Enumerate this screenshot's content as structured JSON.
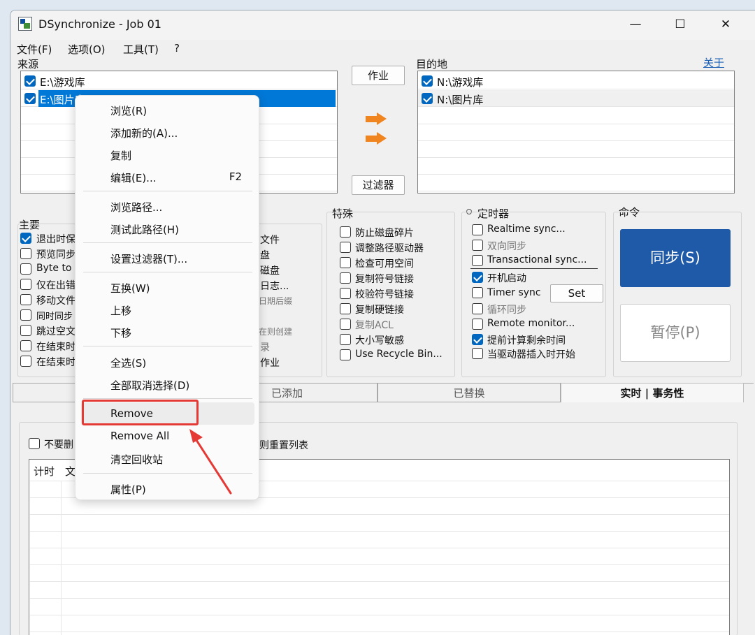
{
  "window": {
    "title": "DSynchronize - Job 01",
    "controls": {
      "minimize": "—",
      "maximize": "☐",
      "close": "✕"
    }
  },
  "menubar": [
    "文件(F)",
    "选项(O)",
    "工具(T)",
    "?"
  ],
  "source": {
    "label": "来源",
    "items": [
      {
        "path": "E:\\游戏库",
        "checked": true,
        "selected": false
      },
      {
        "path": "E:\\图片库",
        "checked": true,
        "selected": true
      }
    ]
  },
  "middle": {
    "job_button": "作业",
    "filter_button": "过滤器",
    "about_link": "关于"
  },
  "destination": {
    "label": "目的地",
    "items": [
      {
        "path": "N:\\游戏库",
        "checked": true
      },
      {
        "path": "N:\\图片库",
        "checked": true
      }
    ]
  },
  "main_group": {
    "label": "主要",
    "options": [
      {
        "text": "退出时保",
        "checked": true
      },
      {
        "text": "预览同步",
        "checked": false
      },
      {
        "text": "Byte to",
        "checked": false
      },
      {
        "text": "仅在出错",
        "checked": false
      },
      {
        "text": "移动文件",
        "checked": false
      },
      {
        "text": "同时同步",
        "checked": false
      },
      {
        "text": "跳过空文",
        "checked": false
      },
      {
        "text": "在结束时",
        "checked": false
      },
      {
        "text": "在结束时",
        "checked": false
      }
    ],
    "col2": [
      "文件",
      "盘",
      "磁盘",
      "日志...",
      "日期后缀",
      "",
      "在则创建",
      "录",
      "作业"
    ]
  },
  "special_group": {
    "label": "特殊",
    "options": [
      {
        "text": "防止磁盘碎片",
        "checked": false,
        "muted": false
      },
      {
        "text": "调整路径驱动器",
        "checked": false,
        "muted": false
      },
      {
        "text": "检查可用空间",
        "checked": false,
        "muted": false
      },
      {
        "text": "复制符号链接",
        "checked": false,
        "muted": false
      },
      {
        "text": "校验符号链接",
        "checked": false,
        "muted": false
      },
      {
        "text": "复制硬链接",
        "checked": false,
        "muted": false
      },
      {
        "text": "复制ACL",
        "checked": false,
        "muted": true
      },
      {
        "text": "大小写敏感",
        "checked": false,
        "muted": false
      },
      {
        "text": "Use Recycle Bin...",
        "checked": false,
        "muted": false
      }
    ]
  },
  "timer_group": {
    "label": "定时器",
    "options": [
      {
        "text": "Realtime sync...",
        "checked": false,
        "muted": false
      },
      {
        "text": "双向同步",
        "checked": false,
        "muted": true
      },
      {
        "text": "Transactional sync...",
        "checked": false,
        "muted": false
      },
      {
        "text": "开机启动",
        "checked": true,
        "muted": false
      },
      {
        "text": "Timer sync",
        "checked": false,
        "muted": false
      },
      {
        "text": "循环同步",
        "checked": false,
        "muted": true
      },
      {
        "text": "Remote monitor...",
        "checked": false,
        "muted": false
      },
      {
        "text": "提前计算剩余时间",
        "checked": true,
        "muted": false
      },
      {
        "text": "当驱动器插入时开始",
        "checked": false,
        "muted": false
      }
    ],
    "set_button": "Set"
  },
  "command_group": {
    "label": "命令",
    "sync_button": "同步(S)",
    "pause_button": "暂停(P)",
    "sync_color": "#1f5aa8"
  },
  "tabs": [
    "已添加",
    "已替换",
    "实时 | 事务性"
  ],
  "bottom": {
    "checkbox_text": "不要删",
    "checkbox_suffix": "则重置列表",
    "columns": [
      "计时",
      "文"
    ]
  },
  "context_menu": {
    "groups": [
      [
        {
          "label": "浏览(R)",
          "shortcut": ""
        },
        {
          "label": "添加新的(A)...",
          "shortcut": ""
        },
        {
          "label": "复制",
          "shortcut": ""
        },
        {
          "label": "编辑(E)...",
          "shortcut": "F2"
        }
      ],
      [
        {
          "label": "浏览路径...",
          "shortcut": ""
        },
        {
          "label": "测试此路径(H)",
          "shortcut": ""
        }
      ],
      [
        {
          "label": "设置过滤器(T)...",
          "shortcut": ""
        }
      ],
      [
        {
          "label": "互换(W)",
          "shortcut": ""
        },
        {
          "label": "上移",
          "shortcut": ""
        },
        {
          "label": "下移",
          "shortcut": ""
        }
      ],
      [
        {
          "label": "全选(S)",
          "shortcut": ""
        },
        {
          "label": "全部取消选择(D)",
          "shortcut": ""
        }
      ],
      [
        {
          "label": "Remove",
          "shortcut": ""
        },
        {
          "label": "Remove All",
          "shortcut": ""
        },
        {
          "label": "清空回收站",
          "shortcut": ""
        }
      ],
      [
        {
          "label": "属性(P)",
          "shortcut": ""
        }
      ]
    ],
    "highlight_color": "#e53935"
  }
}
